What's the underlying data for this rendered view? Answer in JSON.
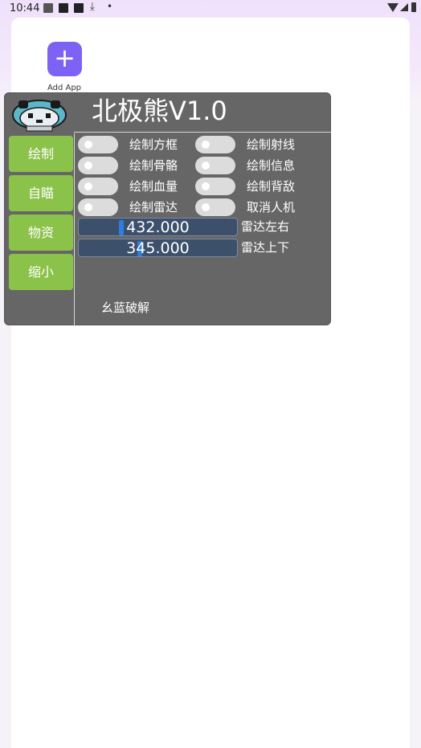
{
  "status_bar": {
    "time": "10:44",
    "icons": [
      "gallery-icon",
      "square-icon",
      "square-icon",
      "download-icon",
      "dot-icon",
      "wifi-icon",
      "signal-icon",
      "battery-icon"
    ]
  },
  "launcher": {
    "add_app_symbol": "+",
    "add_app_label": "Add App"
  },
  "panel": {
    "title": "北极熊V1.0",
    "nav": [
      "绘制",
      "自瞄",
      "物资",
      "缩小"
    ],
    "toggles_left": [
      "绘制方框",
      "绘制骨骼",
      "绘制血量",
      "绘制雷达"
    ],
    "toggles_right": [
      "绘制射线",
      "绘制信息",
      "绘制背敌",
      "取消人机"
    ],
    "sliders": [
      {
        "value": "432.000",
        "label": "雷达左右",
        "fraction": 0.26
      },
      {
        "value": "345.000",
        "label": "雷达上下",
        "fraction": 0.38
      }
    ],
    "footer": "幺蓝破解"
  },
  "colors": {
    "accent": "#7d63f5",
    "panel_bg": "#666666",
    "nav_green": "#8bc24a",
    "slider_bg": "#3c4f6b",
    "slider_thumb": "#2f7de0"
  }
}
